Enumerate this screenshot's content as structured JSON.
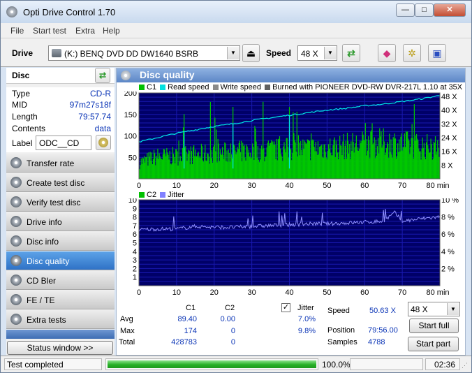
{
  "app": {
    "title": "Opti Drive Control 1.70"
  },
  "window_controls": {
    "minimize": "—",
    "maximize": "□",
    "close": "✕"
  },
  "menu": [
    "File",
    "Start test",
    "Extra",
    "Help"
  ],
  "toolbar": {
    "drive_label": "Drive",
    "drive_value": "(K:)   BENQ DVD DD DW1640 BSRB",
    "speed_label": "Speed",
    "speed_value": "48 X"
  },
  "disc": {
    "header": "Disc",
    "fields": [
      {
        "key": "Type",
        "value": "CD-R"
      },
      {
        "key": "MID",
        "value": "97m27s18f"
      },
      {
        "key": "Length",
        "value": "79:57.74"
      },
      {
        "key": "Contents",
        "value": "data"
      }
    ],
    "label_key": "Label",
    "label_value": "ODC__CD"
  },
  "nav": [
    {
      "label": "Transfer rate",
      "active": false
    },
    {
      "label": "Create test disc",
      "active": false
    },
    {
      "label": "Verify test disc",
      "active": false
    },
    {
      "label": "Drive info",
      "active": false
    },
    {
      "label": "Disc info",
      "active": false
    },
    {
      "label": "Disc quality",
      "active": true
    },
    {
      "label": "CD Bler",
      "active": false
    },
    {
      "label": "FE / TE",
      "active": false
    },
    {
      "label": "Extra tests",
      "active": false
    }
  ],
  "status_window_button": "Status window >>",
  "panel": {
    "title": "Disc quality"
  },
  "top_chart_legend": [
    {
      "label": "C1",
      "color": "#00c000"
    },
    {
      "label": "Read speed",
      "color": "#00e0e0"
    },
    {
      "label": "Write speed",
      "color": "#8a8a8a"
    },
    {
      "label": "Burned with PIONEER DVD-RW  DVR-217L 1.10 at 35X",
      "color": "#606060"
    }
  ],
  "bottom_chart_legend": [
    {
      "label": "C2",
      "color": "#00c000"
    },
    {
      "label": "Jitter",
      "color": "#8080ff"
    }
  ],
  "chart_data": [
    {
      "type": "area",
      "id": "c1-read-speed",
      "x_unit": "min",
      "xlim": [
        0,
        80
      ],
      "xticks": [
        0,
        10,
        20,
        30,
        40,
        50,
        60,
        70,
        80
      ],
      "ylim": [
        0,
        200
      ],
      "yticks": [
        50,
        100,
        150,
        200
      ],
      "y2_unit": "X",
      "y2lim": [
        0,
        50
      ],
      "y2ticks": [
        8,
        16,
        24,
        32,
        40,
        48
      ],
      "series": [
        {
          "name": "C1",
          "x": [
            0,
            5,
            10,
            15,
            20,
            25,
            30,
            35,
            40,
            45,
            50,
            55,
            60,
            65,
            70,
            75,
            80
          ],
          "values": [
            40,
            55,
            55,
            60,
            62,
            65,
            68,
            70,
            72,
            74,
            76,
            80,
            85,
            88,
            85,
            80,
            75
          ]
        },
        {
          "name": "Read speed",
          "x": [
            0,
            5,
            10,
            15,
            20,
            25,
            30,
            35,
            40,
            45,
            50,
            55,
            60,
            65,
            70,
            75,
            80
          ],
          "values": [
            21.5,
            24,
            26.5,
            28.5,
            30.5,
            32,
            34,
            35.5,
            37,
            38.5,
            40,
            41,
            42.5,
            43.5,
            45,
            46.5,
            48.5
          ]
        }
      ]
    },
    {
      "type": "line",
      "id": "c2-jitter",
      "x_unit": "min",
      "xlim": [
        0,
        80
      ],
      "xticks": [
        0,
        10,
        20,
        30,
        40,
        50,
        60,
        70,
        80
      ],
      "ylim": [
        0,
        10
      ],
      "yticks": [
        1,
        2,
        3,
        4,
        5,
        6,
        7,
        8,
        9,
        10
      ],
      "y2_unit": "%",
      "y2lim": [
        0,
        10
      ],
      "y2ticks": [
        2,
        4,
        6,
        8,
        10
      ],
      "series": [
        {
          "name": "C2",
          "x": [
            0,
            80
          ],
          "values": [
            0,
            0
          ]
        },
        {
          "name": "Jitter",
          "x": [
            0,
            5,
            10,
            15,
            20,
            25,
            30,
            35,
            40,
            45,
            50,
            55,
            60,
            65,
            68,
            70,
            75,
            80
          ],
          "values": [
            6.5,
            6.6,
            6.6,
            6.9,
            6.8,
            6.8,
            6.9,
            7.0,
            7.1,
            7.2,
            7.2,
            7.3,
            7.4,
            7.5,
            8.5,
            7.5,
            7.8,
            8.0
          ]
        }
      ]
    }
  ],
  "stats": {
    "col_c1": "C1",
    "col_c2": "C2",
    "rows": [
      {
        "label": "Avg",
        "c1": "89.40",
        "c2": "0.00",
        "jitter": "7.0%"
      },
      {
        "label": "Max",
        "c1": "174",
        "c2": "0",
        "jitter": "9.8%"
      },
      {
        "label": "Total",
        "c1": "428783",
        "c2": "0",
        "jitter": ""
      }
    ],
    "jitter_label": "Jitter",
    "jitter_checked": true
  },
  "run_info": {
    "speed_label": "Speed",
    "speed_value": "50.63 X",
    "position_label": "Position",
    "position_value": "79:56.00",
    "samples_label": "Samples",
    "samples_value": "4788",
    "speed_select": "48 X",
    "start_full": "Start full",
    "start_part": "Start part"
  },
  "status": {
    "text": "Test completed",
    "progress_fraction": 1.0,
    "progress_text": "100.0%",
    "elapsed": "02:36"
  }
}
